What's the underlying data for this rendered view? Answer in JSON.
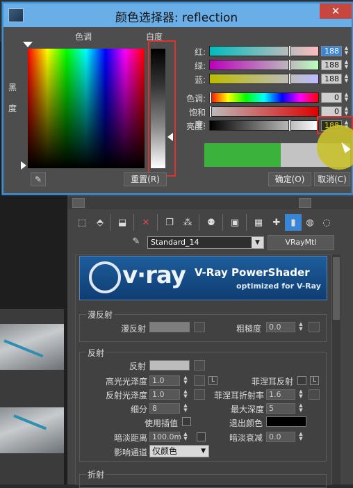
{
  "dialog": {
    "title": "颜色选择器: reflection",
    "hue_label": "色调",
    "whiteness_label": "白度",
    "blackness_label": "黑",
    "blackness_label2": "度",
    "reset_label": "重置(R)",
    "ok_label": "确定(O)",
    "cancel_label": "取消(C)",
    "close_icon": "close-icon",
    "sliders": [
      {
        "label": "红:",
        "value": "188",
        "selected": true,
        "knob_fraction": 0.74
      },
      {
        "label": "绿:",
        "value": "188",
        "selected": false,
        "knob_fraction": 0.74
      },
      {
        "label": "蓝:",
        "value": "188",
        "selected": false,
        "knob_fraction": 0.74
      },
      {
        "label": "色调:",
        "value": "0",
        "selected": false,
        "knob_fraction": 0.0
      },
      {
        "label": "饱和度:",
        "value": "0",
        "selected": false,
        "knob_fraction": 0.0
      },
      {
        "label": "亮度:",
        "value": "188",
        "selected": false,
        "knob_fraction": 0.74
      }
    ],
    "colors": {
      "new_color": "#3bb23b",
      "old_color": "#bcbcbc",
      "highlight": "#e03131",
      "title_bar": "#6aaee8"
    }
  },
  "material_editor": {
    "material_name": "Standard_14",
    "material_type": "VRayMtl",
    "banner": {
      "logo": "v·ray",
      "title": "V-Ray PowerShader",
      "subtitle": "optimized for V-Ray"
    },
    "diffuse": {
      "section": "漫反射",
      "diffuse_label": "漫反射",
      "roughness_label": "粗糙度",
      "roughness_value": "0.0"
    },
    "reflection": {
      "section": "反射",
      "reflect_label": "反射",
      "hilight_gloss_label": "高光光泽度",
      "hilight_gloss_value": "1.0",
      "refl_gloss_label": "反射光泽度",
      "refl_gloss_value": "1.0",
      "subdivs_label": "细分",
      "subdivs_value": "8",
      "use_interp_label": "使用插值",
      "dim_distance_label": "暗淡距离",
      "dim_distance_value": "100.0m",
      "affect_channels_label": "影响通道",
      "affect_channels_value": "仅颜色",
      "fresnel_label": "菲涅耳反射",
      "fresnel_ior_label": "菲涅耳折射率",
      "fresnel_ior_value": "1.6",
      "max_depth_label": "最大深度",
      "max_depth_value": "5",
      "exit_color_label": "退出颜色",
      "dim_falloff_label": "暗淡衰减",
      "dim_falloff_value": "0.0",
      "l_button": "L"
    },
    "refraction": {
      "section": "折射"
    }
  }
}
